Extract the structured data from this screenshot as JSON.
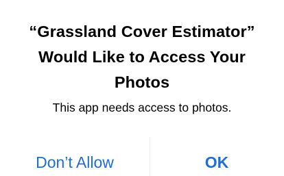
{
  "alert": {
    "title_lines": [
      "“Grassland Cover Estimator”",
      "Would Like to Access Your",
      "Photos"
    ],
    "message": "This app needs access to photos.",
    "buttons": {
      "deny_label": "Don’t Allow",
      "ok_label": "OK"
    },
    "colors": {
      "button_text": "#1f6fd1",
      "background": "#ffffff",
      "text": "#000000"
    }
  }
}
